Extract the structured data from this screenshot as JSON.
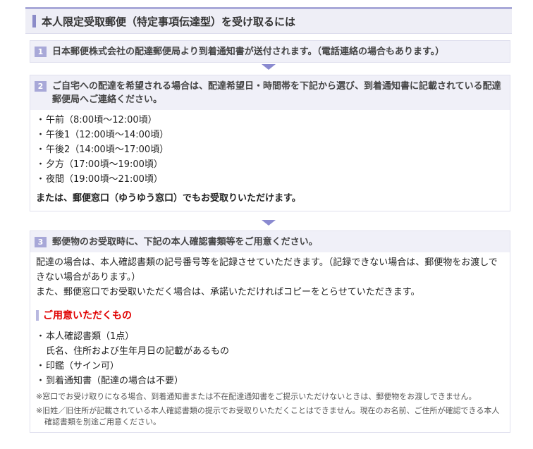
{
  "title": "本人限定受取郵便（特定事項伝達型）を受け取るには",
  "steps": [
    {
      "number": "1",
      "title": "日本郵便株式会社の配達郵便局より到着通知書が送付されます。（電話連絡の場合もあります。）"
    },
    {
      "number": "2",
      "title": "ご自宅への配達を希望される場合は、配達希望日・時間帯を下記から選び、到着通知書に記載されている配達郵便局へご連絡ください。",
      "time_slots": [
        "午前（8:00頃〜12:00頃）",
        "午後1（12:00頃〜14:00頃）",
        "午後2（14:00頃〜17:00頃）",
        "夕方（17:00頃〜19:00頃）",
        "夜間（19:00頃〜21:00頃）"
      ],
      "counter_note": "または、郵便窓口（ゆうゆう窓口）でもお受取りいただけます。"
    },
    {
      "number": "3",
      "title": "郵便物のお受取時に、下記の本人確認書類等をご用意ください。",
      "para1": "配達の場合は、本人確認書類の記号番号等を記録させていただきます。（記録できない場合は、郵便物をお渡しできない場合があります。）",
      "para2": "また、郵便窓口でお受取いただく場合は、承諾いただければコピーをとらせていただきます。",
      "subheading": "ご用意いただくもの",
      "items": [
        {
          "label": "本人確認書類（1点）",
          "detail": "氏名、住所および生年月日の記載があるもの"
        },
        {
          "label": "印鑑（サイン可）"
        },
        {
          "label": "到着通知書（配達の場合は不要）"
        }
      ],
      "notes": [
        "※窓口でお受け取りになる場合、到着通知書または不在配達通知書をご提示いただけないときは、郵便物をお渡しできません。",
        "※旧姓／旧住所が記載されている本人確認書類の提示でお受取りいただくことはできません。現在のお名前、ご住所が確認できる本人確認書類を別途ご用意ください。"
      ]
    }
  ],
  "bullet": "・",
  "colors": {
    "accent": "#8c8cc8",
    "step_bg": "#f0f0f8",
    "subheading": "#e00000"
  }
}
